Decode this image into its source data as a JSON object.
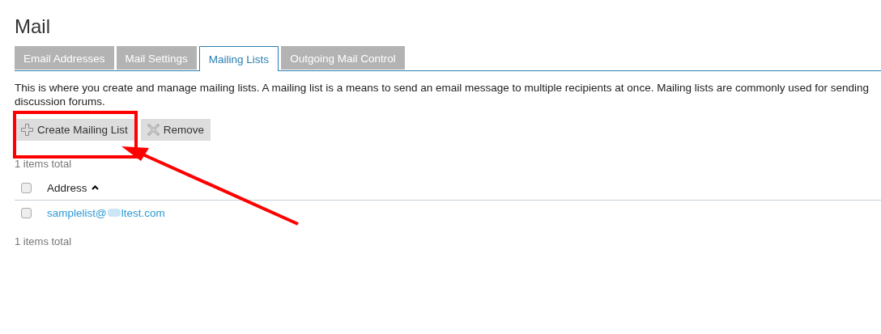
{
  "title": "Mail",
  "tabs": [
    {
      "label": "Email Addresses",
      "selected": false
    },
    {
      "label": "Mail Settings",
      "selected": false
    },
    {
      "label": "Mailing Lists",
      "selected": true
    },
    {
      "label": "Outgoing Mail Control",
      "selected": false
    }
  ],
  "description_lines": [
    "This is where you create and manage mailing lists. A mailing list is a means to send an email message to multiple recipients at once. Mailing lists are commonly used for sending",
    "discussion forums."
  ],
  "toolbar": [
    {
      "label": "Create Mailing List",
      "kind": "create"
    },
    {
      "label": "Remove",
      "kind": "remove"
    }
  ],
  "items_total_top": "1 items total",
  "table": {
    "columns": [
      {
        "label": "Address",
        "sorted": true
      }
    ],
    "select_all_checked": false,
    "rows": [
      {
        "address_start": "samplelist@",
        "address_end": "ltest.com",
        "checked": false
      }
    ]
  },
  "items_total_bottom": "1 items total",
  "annotation": {
    "highlight": true,
    "arrow": true
  }
}
